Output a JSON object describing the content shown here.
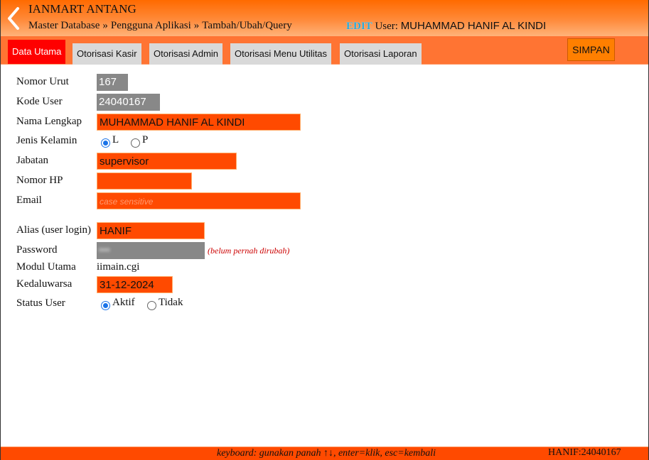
{
  "header": {
    "app_title": "IANMART ANTANG",
    "breadcrumb": [
      "Master Database",
      "Pengguna Aplikasi",
      "Tambah/Ubah/Query"
    ],
    "breadcrumb_sep": "»",
    "edit_tag": "EDIT",
    "user_label": "User:",
    "user_name": "MUHAMMAD HANIF AL KINDI"
  },
  "tabs": [
    {
      "label": "Data Utama",
      "active": true
    },
    {
      "label": "Otorisasi Kasir",
      "active": false
    },
    {
      "label": "Otorisasi Admin",
      "active": false
    },
    {
      "label": "Otorisasi Menu Utilitas",
      "active": false
    },
    {
      "label": "Otorisasi Laporan",
      "active": false
    }
  ],
  "toolbar": {
    "save_label": "SIMPAN"
  },
  "form": {
    "nomor_urut": {
      "label": "Nomor Urut",
      "value": "167"
    },
    "kode_user": {
      "label": "Kode User",
      "value": "24040167"
    },
    "nama_lengkap": {
      "label": "Nama Lengkap",
      "value": "MUHAMMAD HANIF AL KINDI"
    },
    "jenis_kelamin": {
      "label": "Jenis Kelamin",
      "options": [
        "L",
        "P"
      ],
      "selected": "L"
    },
    "jabatan": {
      "label": "Jabatan",
      "value": "supervisor"
    },
    "nomor_hp": {
      "label": "Nomor HP",
      "value": ""
    },
    "email": {
      "label": "Email",
      "value": "",
      "placeholder": "case sensitive"
    },
    "alias": {
      "label": "Alias (user login)",
      "value": "HANIF"
    },
    "password": {
      "label": "Password",
      "value": "•••",
      "note": "(belum pernah dirubah)"
    },
    "modul_utama": {
      "label": "Modul Utama",
      "value": "iimain.cgi"
    },
    "kedaluwarsa": {
      "label": "Kedaluwarsa",
      "value": "31-12-2024"
    },
    "status_user": {
      "label": "Status User",
      "options": [
        "Aktif",
        "Tidak"
      ],
      "selected": "Aktif"
    }
  },
  "footer": {
    "keyboard_hint": "keyboard: gunakan panah ↑↓, enter=klik, esc=kembali",
    "current_user": "HANIF:24040167"
  },
  "colors": {
    "header_orange": "#ff6a00",
    "field_orange": "#ff4a00",
    "field_gray": "#888888",
    "active_tab": "#ff0000",
    "edit_tag": "#2aa8d8",
    "note_red": "#cc0000"
  }
}
